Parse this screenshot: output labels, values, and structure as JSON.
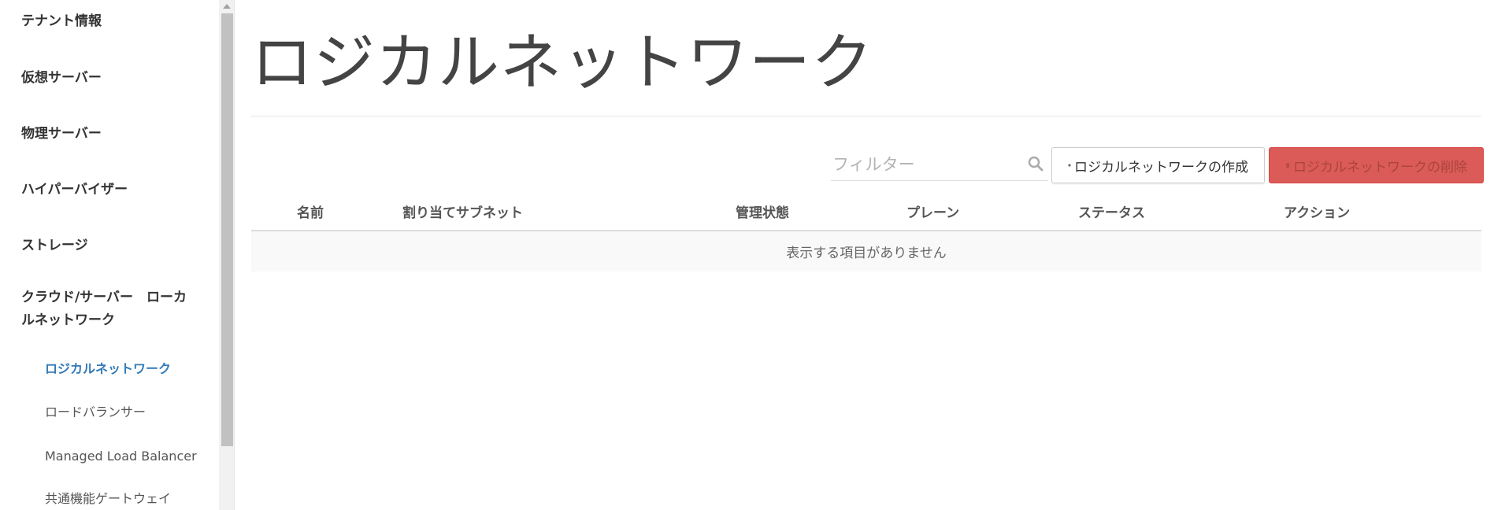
{
  "sidebar": {
    "items": [
      {
        "label": "テナント情報"
      },
      {
        "label": "仮想サーバー"
      },
      {
        "label": "物理サーバー"
      },
      {
        "label": "ハイパーバイザー"
      },
      {
        "label": "ストレージ"
      },
      {
        "label": "クラウド/サーバー　ローカルネットワーク"
      }
    ],
    "subitems": [
      {
        "label": "ロジカルネットワーク",
        "active": true
      },
      {
        "label": "ロードバランサー"
      },
      {
        "label": "Managed Load Balancer"
      },
      {
        "label": "共通機能ゲートウェイ"
      }
    ]
  },
  "main": {
    "title": "ロジカルネットワーク",
    "filter": {
      "placeholder": "フィルター",
      "value": ""
    },
    "buttons": {
      "create": "ロジカルネットワークの作成",
      "delete": "ロジカルネットワークの削除"
    },
    "table": {
      "headers": [
        "名前",
        "割り当てサブネット",
        "管理状態",
        "プレーン",
        "ステータス",
        "アクション"
      ],
      "empty_message": "表示する項目がありません"
    }
  },
  "colors": {
    "accent": "#337ab7",
    "danger": "#d9534f"
  },
  "icons": {
    "search": "search-icon",
    "plus": "plus-icon",
    "trash": "trash-icon"
  }
}
